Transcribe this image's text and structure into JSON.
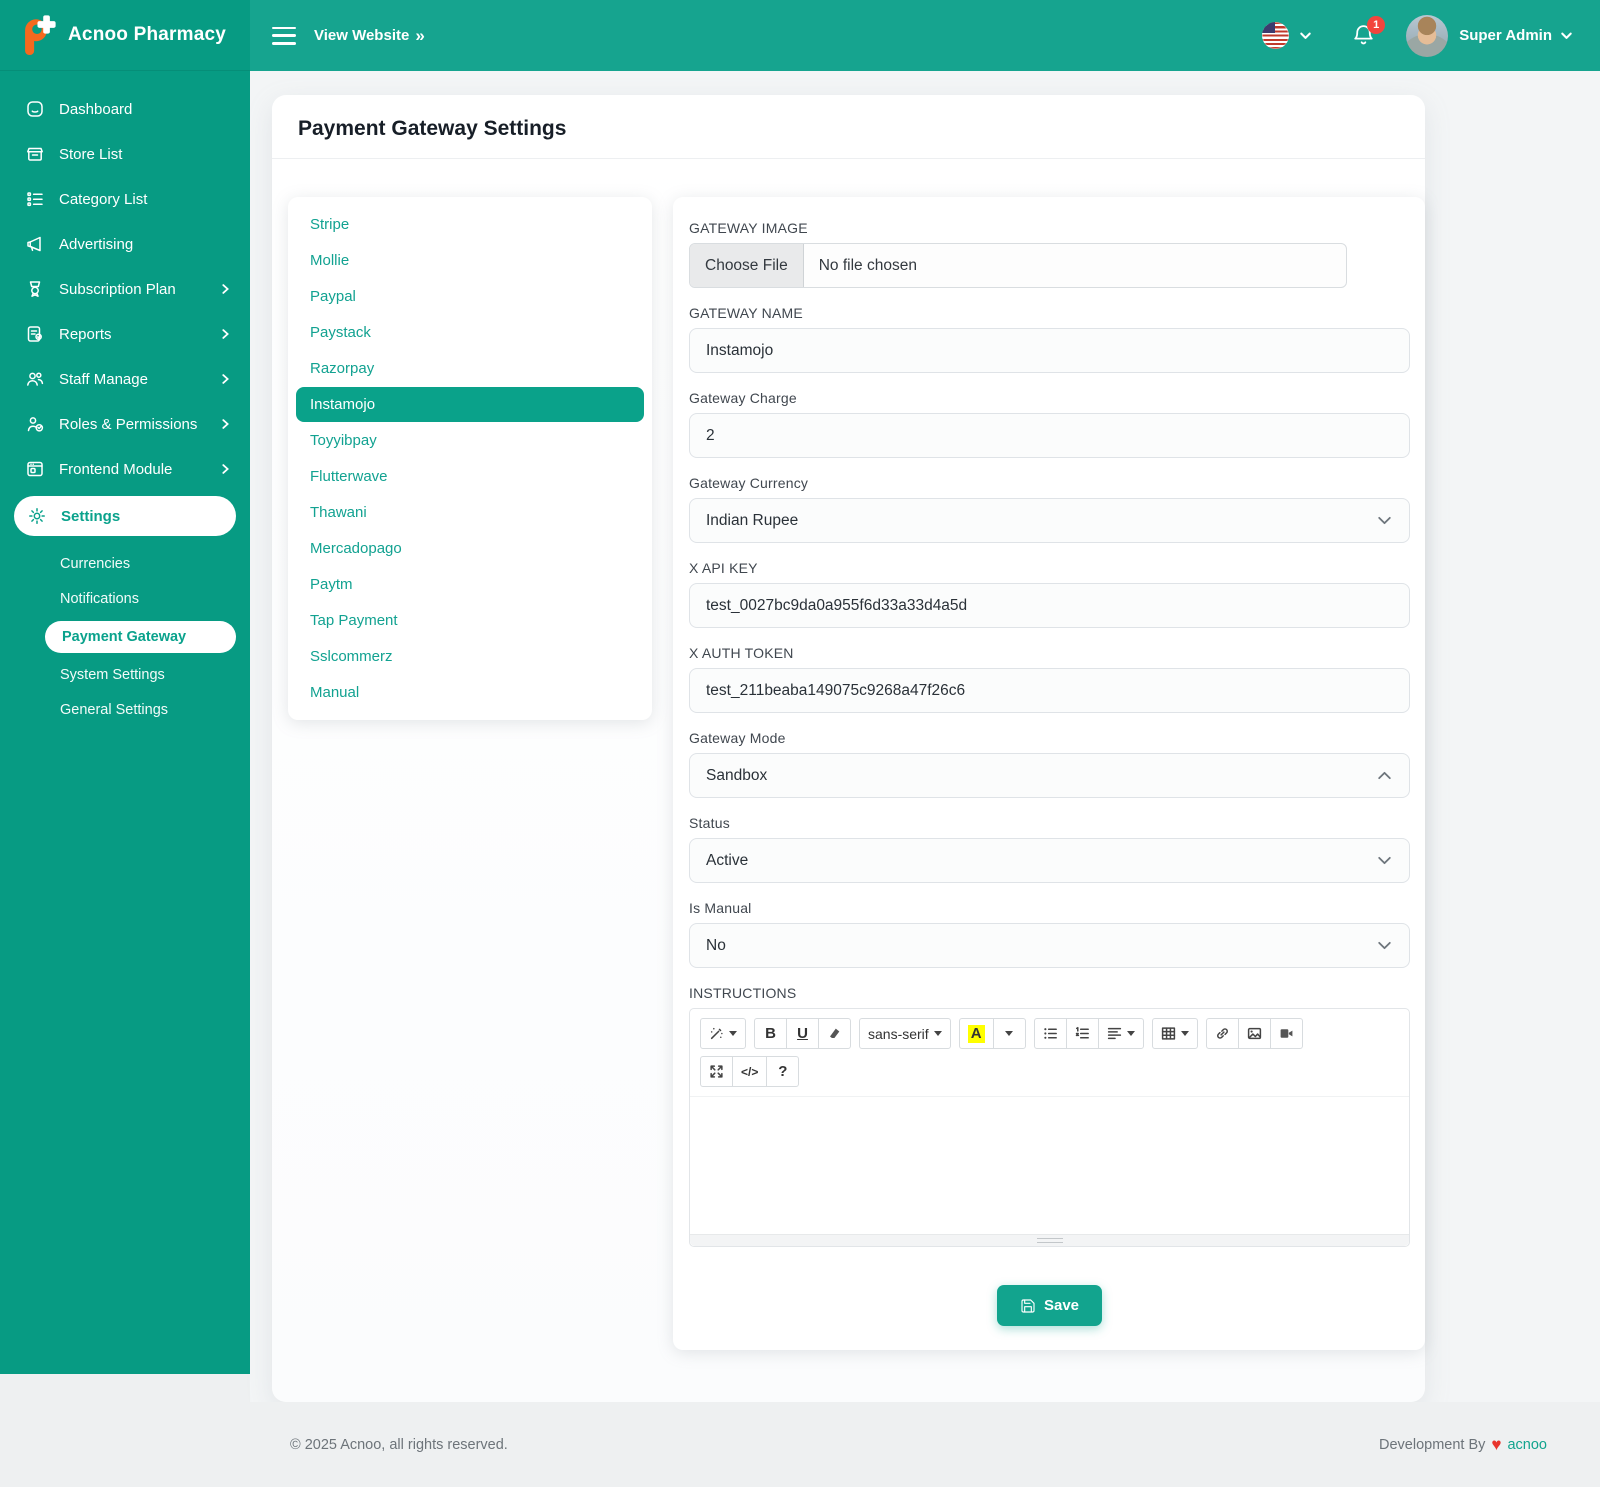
{
  "brand": {
    "name": "Acnoo Pharmacy",
    "logo_icon": "pharmacy-plus-icon"
  },
  "header": {
    "view_website": "View Website",
    "icons": [
      "hamburger-icon",
      "double-chevron-right-icon",
      "us-flag-icon",
      "chevron-down-icon",
      "bell-icon"
    ],
    "notification_count": "1",
    "user": {
      "name": "Super Admin",
      "avatar": "avatar-photo"
    }
  },
  "sidebar": {
    "items": [
      {
        "label": "Dashboard",
        "icon": "dashboard-icon",
        "has_submenu": false,
        "active": false
      },
      {
        "label": "Store List",
        "icon": "store-icon",
        "has_submenu": false,
        "active": false
      },
      {
        "label": "Category List",
        "icon": "category-icon",
        "has_submenu": false,
        "active": false
      },
      {
        "label": "Advertising",
        "icon": "advertising-icon",
        "has_submenu": false,
        "active": false
      },
      {
        "label": "Subscription Plan",
        "icon": "subscription-icon",
        "has_submenu": true,
        "active": false
      },
      {
        "label": "Reports",
        "icon": "reports-icon",
        "has_submenu": true,
        "active": false
      },
      {
        "label": "Staff Manage",
        "icon": "staff-icon",
        "has_submenu": true,
        "active": false
      },
      {
        "label": "Roles & Permissions",
        "icon": "roles-icon",
        "has_submenu": true,
        "active": false
      },
      {
        "label": "Frontend Module",
        "icon": "frontend-icon",
        "has_submenu": true,
        "active": false
      },
      {
        "label": "Settings",
        "icon": "settings-icon",
        "has_submenu": false,
        "active": true
      }
    ],
    "settings_submenu": [
      {
        "label": "Currencies",
        "active": false
      },
      {
        "label": "Notifications",
        "active": false
      },
      {
        "label": "Payment Gateway",
        "active": true
      },
      {
        "label": "System Settings",
        "active": false
      },
      {
        "label": "General Settings",
        "active": false
      }
    ]
  },
  "page": {
    "title": "Payment Gateway Settings"
  },
  "gateways": [
    {
      "label": "Stripe",
      "active": false
    },
    {
      "label": "Mollie",
      "active": false
    },
    {
      "label": "Paypal",
      "active": false
    },
    {
      "label": "Paystack",
      "active": false
    },
    {
      "label": "Razorpay",
      "active": false
    },
    {
      "label": "Instamojo",
      "active": true
    },
    {
      "label": "Toyyibpay",
      "active": false
    },
    {
      "label": "Flutterwave",
      "active": false
    },
    {
      "label": "Thawani",
      "active": false
    },
    {
      "label": "Mercadopago",
      "active": false
    },
    {
      "label": "Paytm",
      "active": false
    },
    {
      "label": "Tap Payment",
      "active": false
    },
    {
      "label": "Sslcommerz",
      "active": false
    },
    {
      "label": "Manual",
      "active": false
    }
  ],
  "form": {
    "gateway_image": {
      "label": "GATEWAY IMAGE",
      "button": "Choose File",
      "status": "No file chosen"
    },
    "gateway_name": {
      "label": "GATEWAY NAME",
      "value": "Instamojo"
    },
    "gateway_charge": {
      "label": "Gateway Charge",
      "value": "2"
    },
    "gateway_currency": {
      "label": "Gateway Currency",
      "value": "Indian Rupee",
      "chevron": "down"
    },
    "x_api_key": {
      "label": "X API KEY",
      "value": "test_0027bc9da0a955f6d33a33d4a5d"
    },
    "x_auth_token": {
      "label": "X AUTH TOKEN",
      "value": "test_211beaba149075c9268a47f26c6"
    },
    "gateway_mode": {
      "label": "Gateway Mode",
      "value": "Sandbox",
      "chevron": "up"
    },
    "status": {
      "label": "Status",
      "value": "Active",
      "chevron": "down"
    },
    "is_manual": {
      "label": "Is Manual",
      "value": "No",
      "chevron": "down"
    },
    "instructions": {
      "label": "INSTRUCTIONS",
      "font_family": "sans-serif",
      "editor_value": "",
      "toolbar_rows": [
        [
          [
            "style-dropdown"
          ],
          [
            "bold",
            "underline",
            "eraser"
          ],
          [
            "font-family"
          ],
          [
            "color",
            "color-caret"
          ],
          [
            "unordered-list",
            "ordered-list",
            "paragraph"
          ],
          [
            "table"
          ],
          [
            "link",
            "picture",
            "video"
          ]
        ],
        [
          [
            "fullscreen",
            "codeview",
            "help"
          ]
        ]
      ]
    },
    "save_label": "Save"
  },
  "footer": {
    "copyright": "© 2025 Acnoo, all rights reserved.",
    "development": "Development By",
    "heart_icon": "heart-icon",
    "brand": "acnoo"
  },
  "colors": {
    "sidebar_teal": "#079b83",
    "header_teal": "#16a48f",
    "accent_teal": "#12a48e",
    "active_gateway": "#0aa28a",
    "badge_red": "#f2453d",
    "heart_red": "#e8342c",
    "logo_orange": "#f4691e"
  }
}
